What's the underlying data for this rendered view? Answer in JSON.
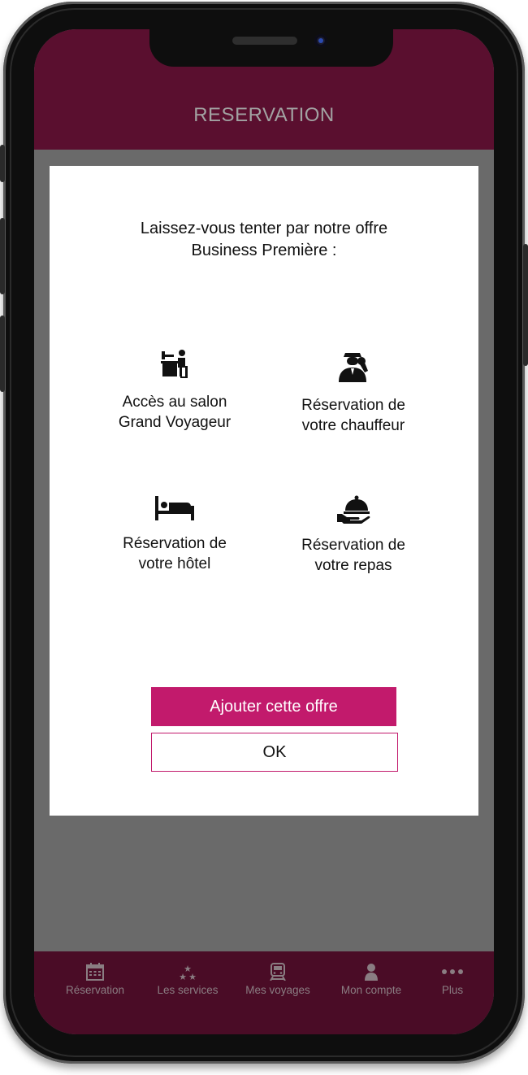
{
  "header": {
    "title": "RESERVATION"
  },
  "dialog": {
    "intro_line1": "Laissez-vous tenter par notre offre",
    "intro_line2": "Business Première :",
    "features": [
      {
        "icon": "desk-worker-icon",
        "line1": "Accès au salon",
        "line2": "Grand Voyageur"
      },
      {
        "icon": "chauffeur-icon",
        "line1": "Réservation de",
        "line2": "votre chauffeur"
      },
      {
        "icon": "bed-icon",
        "line1": "Réservation de",
        "line2": "votre hôtel"
      },
      {
        "icon": "cloche-icon",
        "line1": "Réservation de",
        "line2": "votre repas"
      }
    ],
    "primary_button": "Ajouter cette offre",
    "secondary_button": "OK"
  },
  "tabbar": {
    "items": [
      {
        "icon": "calendar-icon",
        "label": "Réservation",
        "active": true
      },
      {
        "icon": "stars-icon",
        "label": "Les services",
        "active": false
      },
      {
        "icon": "train-icon",
        "label": "Mes voyages",
        "active": false
      },
      {
        "icon": "person-icon",
        "label": "Mon compte",
        "active": false
      },
      {
        "icon": "more-dots-icon",
        "label": "Plus",
        "active": false
      }
    ]
  },
  "colors": {
    "header_bg": "#5a0f2f",
    "tabbar_bg": "#4a0c26",
    "accent": "#c21a6c",
    "overlay": "#6a6a6a"
  }
}
